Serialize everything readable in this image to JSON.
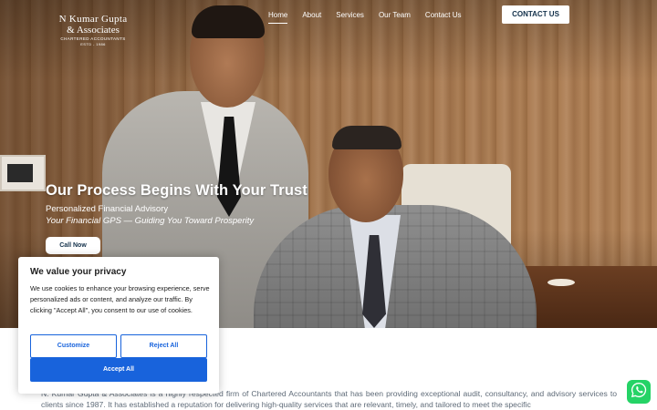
{
  "brand": {
    "line1": "N Kumar Gupta",
    "line2": "& Associates",
    "line3": "CHARTERED ACCOUNTANTS",
    "line4": "ESTD - 1986"
  },
  "nav": {
    "items": [
      {
        "label": "Home",
        "active": true
      },
      {
        "label": "About",
        "active": false
      },
      {
        "label": "Services",
        "active": false
      },
      {
        "label": "Our Team",
        "active": false
      },
      {
        "label": "Contact Us",
        "active": false
      }
    ],
    "contact_button": "CONTACT US"
  },
  "hero": {
    "title": "Our Process Begins With Your Trust",
    "subtitle": "Personalized Financial Advisory",
    "tagline": "Your Financial GPS — Guiding You Toward Prosperity",
    "cta": "Call Now"
  },
  "about": {
    "text": "N. Kumar Gupta & Associates is a highly respected firm of Chartered Accountants that has been providing exceptional audit, consultancy, and advisory services to clients since 1987. It has established a reputation for delivering high-quality services that are relevant, timely, and tailored to meet the specific"
  },
  "cookie_banner": {
    "title": "We value your privacy",
    "body": "We use cookies to enhance your browsing experience, serve personalized ads or content, and analyze our traffic. By clicking \"Accept All\", you consent to our use of cookies.",
    "customize": "Customize",
    "reject": "Reject All",
    "accept": "Accept All"
  },
  "colors": {
    "primary_blue": "#1863dc",
    "navy": "#12304a",
    "whatsapp": "#25d366"
  },
  "icons": {
    "floating_chat": "whatsapp-icon"
  }
}
